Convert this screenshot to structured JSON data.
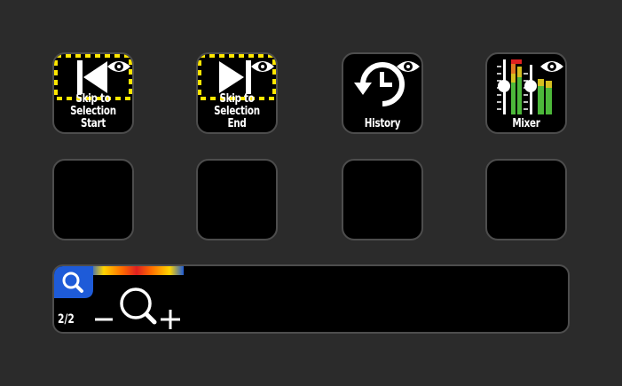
{
  "keys": [
    {
      "id": "skip-start",
      "label": "Skip to\nSelection Start",
      "icon": "skip-to-start-icon"
    },
    {
      "id": "skip-end",
      "label": "Skip to\nSelection End",
      "icon": "skip-to-end-icon"
    },
    {
      "id": "history",
      "label": "History",
      "icon": "history-icon"
    },
    {
      "id": "mixer",
      "label": "Mixer",
      "icon": "mixer-icon"
    },
    {
      "id": "empty-5",
      "label": ""
    },
    {
      "id": "empty-6",
      "label": ""
    },
    {
      "id": "empty-7",
      "label": ""
    },
    {
      "id": "empty-8",
      "label": ""
    }
  ],
  "dial": {
    "icon": "zoom-icon",
    "page": "2/2"
  },
  "colors": {
    "background": "#2b2b2b",
    "key_border": "#4d4d4d",
    "selection_dash": "#ffe600",
    "zoom_badge": "#1e5bd8"
  }
}
